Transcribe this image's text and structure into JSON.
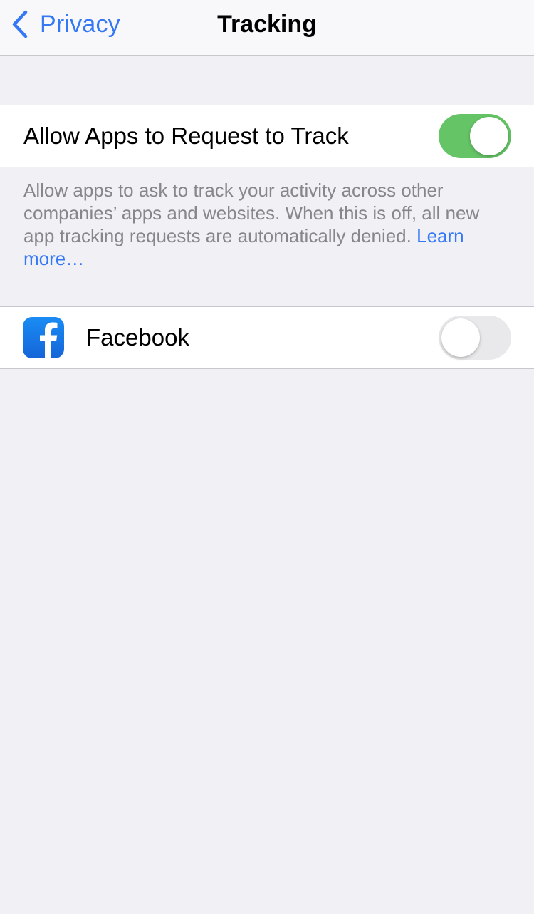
{
  "navbar": {
    "back_label": "Privacy",
    "title": "Tracking"
  },
  "allow_section": {
    "label": "Allow Apps to Request to Track",
    "toggle_state": "on",
    "footer_text": "Allow apps to ask to track your activity across other companies’ apps and websites. When this is off, all new app tracking requests are automatically denied.",
    "learn_more_label": "Learn more…"
  },
  "apps": [
    {
      "name": "Facebook",
      "icon": "facebook-icon",
      "toggle_state": "off"
    }
  ],
  "colors": {
    "accent": "#3478f6",
    "toggle_on": "#65c466",
    "toggle_off": "#e9e9eb",
    "background": "#f0f0f5",
    "facebook_blue": "#1877f2"
  }
}
